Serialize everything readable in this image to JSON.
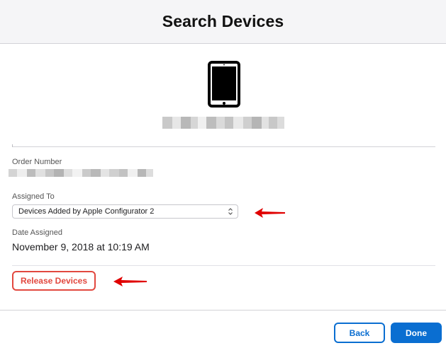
{
  "header": {
    "title": "Search Devices"
  },
  "device": {
    "icon": "ipad-icon"
  },
  "fields": {
    "order_number_label": "Order Number",
    "assigned_to_label": "Assigned To",
    "assigned_to_value": "Devices Added by Apple Configurator 2",
    "date_assigned_label": "Date Assigned",
    "date_assigned_value": "November 9, 2018 at 10:19 AM"
  },
  "actions": {
    "release_label": "Release Devices",
    "back_label": "Back",
    "done_label": "Done"
  },
  "colors": {
    "accent_blue": "#0a6ed1",
    "destructive_red": "#e2483f",
    "annotation_arrow": "#e00000"
  }
}
